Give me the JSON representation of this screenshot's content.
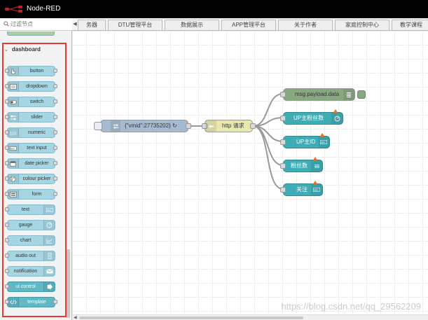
{
  "app": {
    "title": "Node-RED"
  },
  "palette": {
    "filter_placeholder": "过滤节点",
    "category": "dashboard",
    "nodes": [
      {
        "label": "button",
        "icon": "hand-pointer-icon"
      },
      {
        "label": "dropdown",
        "icon": "list-icon"
      },
      {
        "label": "switch",
        "icon": "toggle-icon"
      },
      {
        "label": "slider",
        "icon": "sliders-icon"
      },
      {
        "label": "numeric",
        "icon": "numeric-icon"
      },
      {
        "label": "text input",
        "icon": "text-input-icon"
      },
      {
        "label": "date picker",
        "icon": "calendar-icon"
      },
      {
        "label": "colour picker",
        "icon": "palette-icon"
      },
      {
        "label": "form",
        "icon": "form-icon"
      },
      {
        "label": "text",
        "icon": "abc-icon"
      },
      {
        "label": "gauge",
        "icon": "gauge-icon"
      },
      {
        "label": "chart",
        "icon": "chart-icon"
      },
      {
        "label": "audio out",
        "icon": "speaker-icon"
      },
      {
        "label": "notification",
        "icon": "envelope-icon"
      },
      {
        "label": "ui control",
        "icon": "arrow-right-icon"
      },
      {
        "label": "template",
        "icon": "code-icon"
      }
    ]
  },
  "tabs": [
    {
      "label": "务器"
    },
    {
      "label": "DTU管理平台"
    },
    {
      "label": "数据展示"
    },
    {
      "label": "APP管理平台"
    },
    {
      "label": "关于作者"
    },
    {
      "label": "家庭控制中心"
    },
    {
      "label": "教学课程"
    }
  ],
  "flow": {
    "inject": {
      "label": "{\"vmid\":27735202} ↻"
    },
    "http": {
      "label": "http 请求"
    },
    "debug": {
      "label": "msg.payload.data"
    },
    "gauge": {
      "label": "UP主粉丝数"
    },
    "text_id": {
      "label": "UP主ID"
    },
    "fans": {
      "label": "粉丝数"
    },
    "follow": {
      "label": "关注"
    }
  },
  "watermark": "https://blog.csdn.net/qq_29562209",
  "colors": {
    "dashboard_node": "#a6d6e3",
    "inject_node": "#a6bbcf",
    "http_node": "#e7e7ae",
    "debug_node": "#87a980",
    "dashboard_flow_node": "#3fadb5",
    "changed_marker": "#f07020",
    "highlight_outline": "#e53935"
  }
}
